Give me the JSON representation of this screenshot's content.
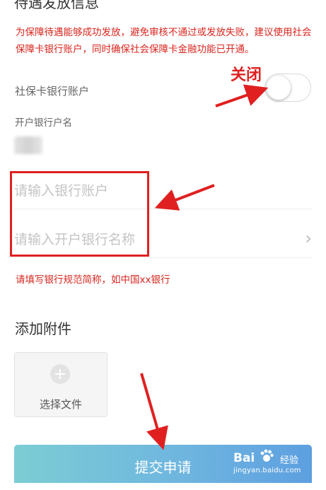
{
  "page": {
    "section_title": "待遇发放信息",
    "notice": "为保障待遇能够成功发放，避免审核不通过或发放失败，建议使用社会保障卡银行账户，同时确保社会保障卡金融功能已开通。"
  },
  "bank_toggle": {
    "label": "社保卡银行账户",
    "state": "off"
  },
  "account_name": {
    "label": "开户银行户名"
  },
  "inputs": {
    "account_placeholder": "请输入银行账户",
    "bank_name_placeholder": "请输入开户银行名称"
  },
  "hint": "请填写银行规范简称，如中国xx银行",
  "attachments": {
    "title": "添加附件",
    "select_file_label": "选择文件"
  },
  "submit": {
    "label": "提交申请"
  },
  "annotations": {
    "toggle_note": "关闭",
    "color": "#e02020"
  },
  "watermark": {
    "brand_left": "Bai",
    "brand_right": "经验",
    "url": "jingyan.baidu.com"
  },
  "colors": {
    "warning_text": "#d8261f",
    "button_gradient_start": "#7ccdd4",
    "button_gradient_end": "#5d9fe0"
  }
}
